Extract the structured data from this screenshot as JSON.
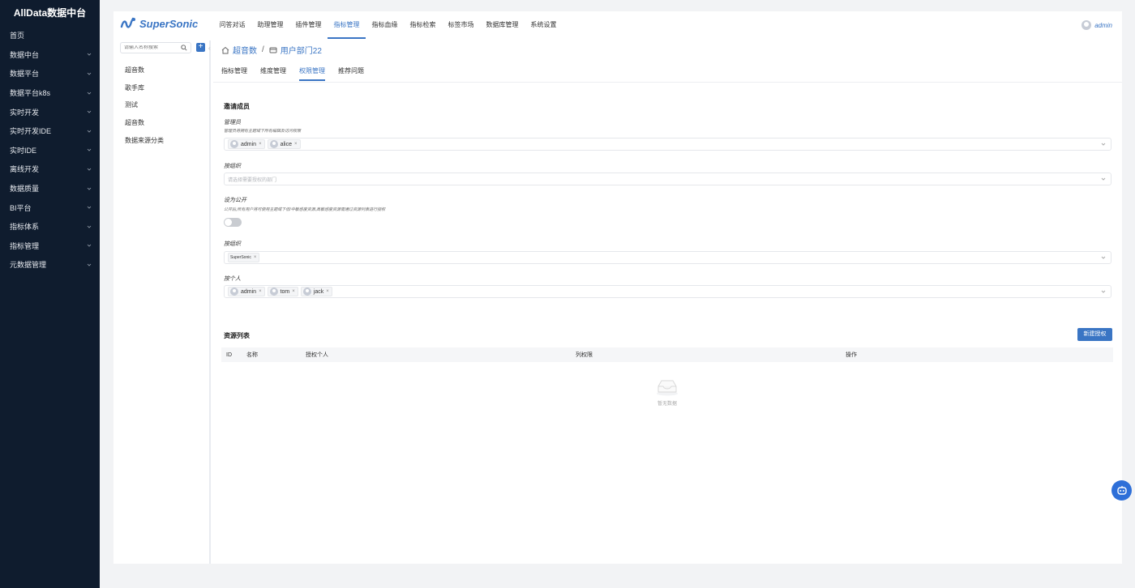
{
  "sidebar": {
    "title": "AllData数据中台",
    "items": [
      {
        "label": "首页",
        "chevron": false
      },
      {
        "label": "数据中台",
        "chevron": true
      },
      {
        "label": "数据平台",
        "chevron": true
      },
      {
        "label": "数据平台k8s",
        "chevron": true
      },
      {
        "label": "实时开发",
        "chevron": true
      },
      {
        "label": "实时开发IDE",
        "chevron": true
      },
      {
        "label": "实时IDE",
        "chevron": true
      },
      {
        "label": "离线开发",
        "chevron": true
      },
      {
        "label": "数据质量",
        "chevron": true
      },
      {
        "label": "BI平台",
        "chevron": true
      },
      {
        "label": "指标体系",
        "chevron": true
      },
      {
        "label": "指标管理",
        "chevron": true
      },
      {
        "label": "元数据管理",
        "chevron": true
      }
    ]
  },
  "header": {
    "logo_text": "SuperSonic",
    "nav": [
      "问答对话",
      "助理管理",
      "插件管理",
      "指标管理",
      "指标血缘",
      "指标检索",
      "标签市场",
      "数据库管理",
      "系统设置"
    ],
    "active_nav": "指标管理",
    "user": "admin"
  },
  "tree": {
    "search_placeholder": "请输入名称搜索",
    "add_label": "+",
    "items": [
      "超音数",
      "歌手库",
      "测试",
      "超音数",
      "数据来源分类"
    ]
  },
  "breadcrumb": {
    "root": "超音数",
    "sep": "/",
    "current": "用户部门22"
  },
  "tabs": [
    "指标管理",
    "维度管理",
    "权限管理",
    "推荐问题"
  ],
  "active_tab": "权限管理",
  "invite": {
    "title": "邀请成员",
    "admin_label": "管理员",
    "admin_hint": "管理员将拥有主题域下所有编辑及访问权限",
    "admins": [
      "admin",
      "alice"
    ],
    "org_label": "按组织",
    "org_placeholder": "请选择需要授权的部门",
    "public_label": "设为公开",
    "public_hint": "公开后,所有用户将可使用主题域下低/中敏感度资源,高敏感度资源需通过资源列表进行授权",
    "public_enabled": false,
    "org2_label": "按组织",
    "orgs": [
      "SuperSonic"
    ],
    "person_label": "按个人",
    "persons": [
      "admin",
      "tom",
      "jack"
    ]
  },
  "resources": {
    "title": "资源列表",
    "new_button": "新建授权",
    "columns": [
      "ID",
      "名称",
      "授权个人",
      "列权限",
      "操作"
    ],
    "empty_text": "暂无数据"
  },
  "colors": {
    "accent": "#3a75c4",
    "sidebar_bg": "#0f1c2e"
  }
}
